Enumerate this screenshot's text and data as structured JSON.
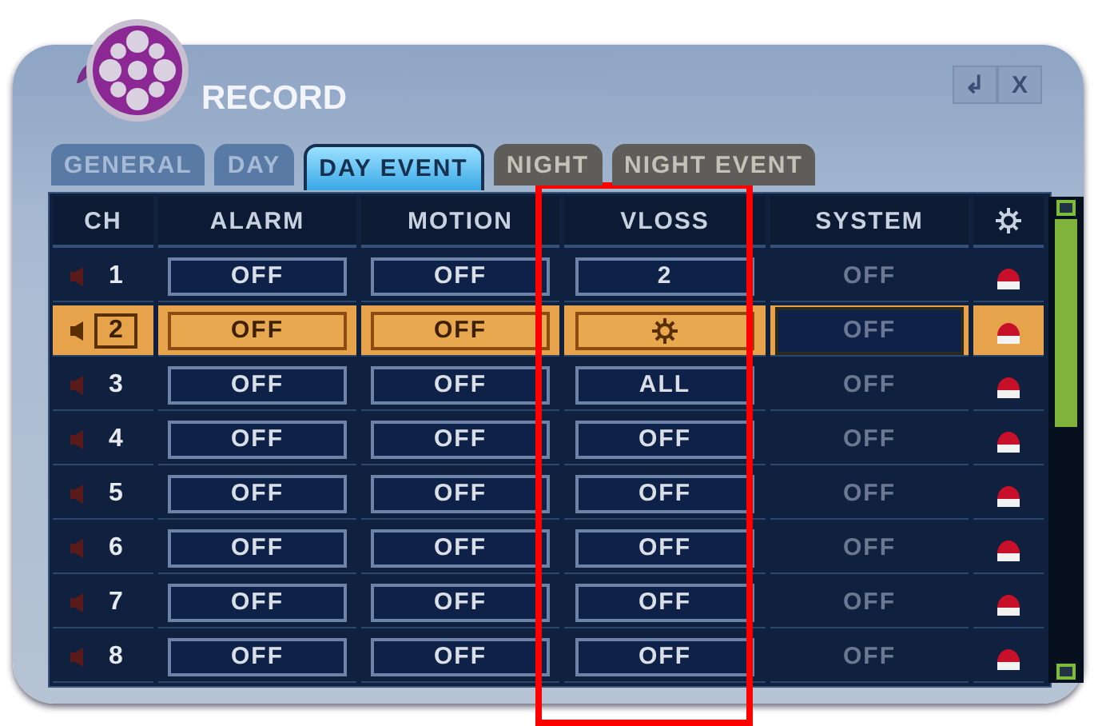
{
  "window": {
    "title": "RECORD",
    "buttons": [
      "↲",
      "X"
    ]
  },
  "tabs": [
    {
      "label": "GENERAL",
      "selected": false,
      "disabled": false
    },
    {
      "label": "DAY",
      "selected": false,
      "disabled": false
    },
    {
      "label": "DAY EVENT",
      "selected": true,
      "disabled": false
    },
    {
      "label": "NIGHT",
      "selected": false,
      "disabled": true
    },
    {
      "label": "NIGHT EVENT",
      "selected": false,
      "disabled": true
    }
  ],
  "table": {
    "columns": [
      "CH",
      "ALARM",
      "MOTION",
      "VLOSS",
      "SYSTEM"
    ],
    "rows": [
      {
        "ch": "1",
        "selected": false,
        "alarm": "OFF",
        "motion": "OFF",
        "vloss": {
          "kind": "text",
          "value": "2"
        },
        "system": "OFF"
      },
      {
        "ch": "2",
        "selected": true,
        "alarm": "OFF",
        "motion": "OFF",
        "vloss": {
          "kind": "cursor"
        },
        "system": "OFF"
      },
      {
        "ch": "3",
        "selected": false,
        "alarm": "OFF",
        "motion": "OFF",
        "vloss": {
          "kind": "text",
          "value": "ALL"
        },
        "system": "OFF"
      },
      {
        "ch": "4",
        "selected": false,
        "alarm": "OFF",
        "motion": "OFF",
        "vloss": {
          "kind": "text",
          "value": "OFF"
        },
        "system": "OFF"
      },
      {
        "ch": "5",
        "selected": false,
        "alarm": "OFF",
        "motion": "OFF",
        "vloss": {
          "kind": "text",
          "value": "OFF"
        },
        "system": "OFF"
      },
      {
        "ch": "6",
        "selected": false,
        "alarm": "OFF",
        "motion": "OFF",
        "vloss": {
          "kind": "text",
          "value": "OFF"
        },
        "system": "OFF"
      },
      {
        "ch": "7",
        "selected": false,
        "alarm": "OFF",
        "motion": "OFF",
        "vloss": {
          "kind": "text",
          "value": "OFF"
        },
        "system": "OFF"
      },
      {
        "ch": "8",
        "selected": false,
        "alarm": "OFF",
        "motion": "OFF",
        "vloss": {
          "kind": "text",
          "value": "OFF"
        },
        "system": "OFF"
      }
    ]
  }
}
